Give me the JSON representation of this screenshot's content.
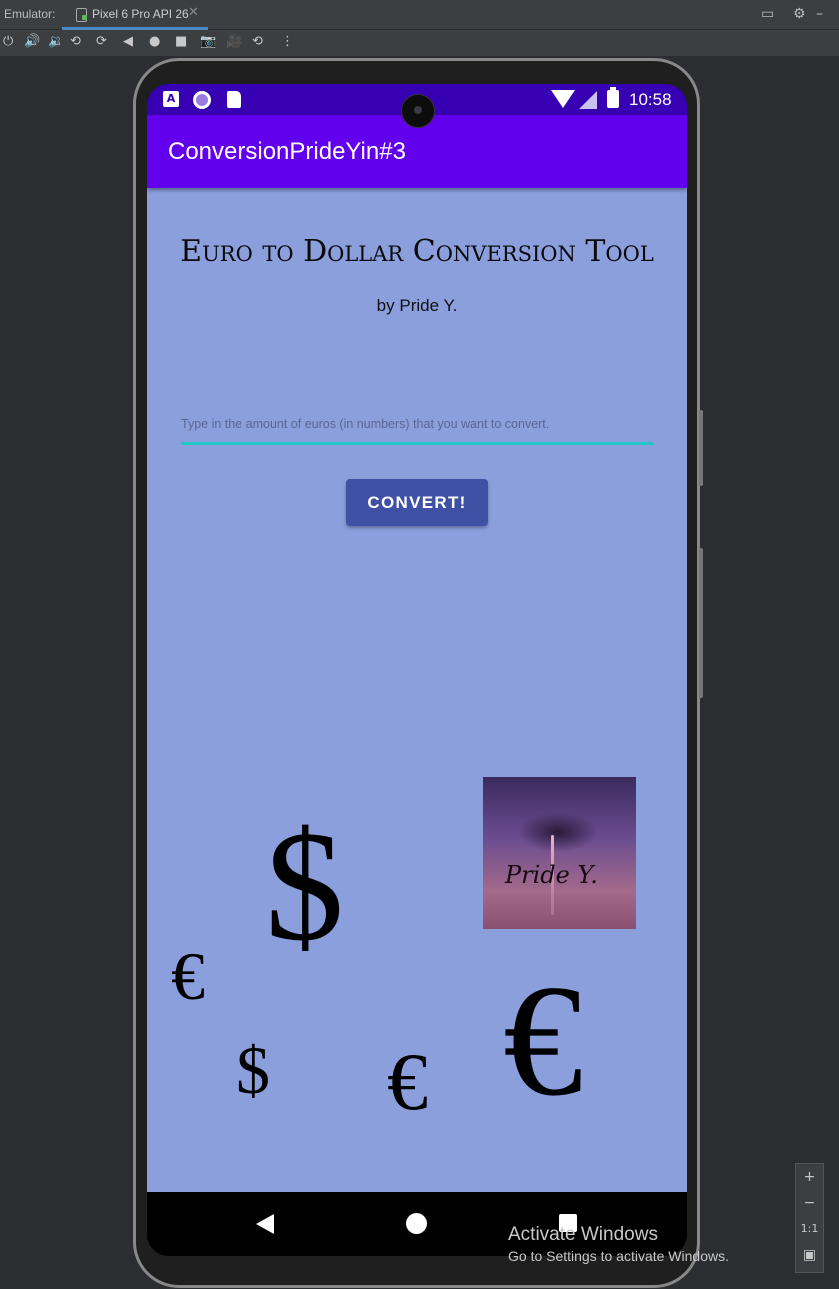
{
  "emulator": {
    "label": "Emulator:",
    "device_tab": "Pixel 6 Pro API 26",
    "tab_close": "✕"
  },
  "toolbar_icons": [
    "power-icon",
    "volume-up-icon",
    "volume-down-icon",
    "rotate-left-icon",
    "rotate-right-icon",
    "back-icon",
    "home-icon",
    "overview-icon",
    "screenshot-icon",
    "record-icon",
    "snapshot-icon",
    "more-icon"
  ],
  "status_bar": {
    "time": "10:58",
    "notif_letter": "A"
  },
  "app_bar": {
    "title": "ConversionPrideYin#3"
  },
  "main": {
    "heading": "Euro to Dollar Conversion Tool",
    "byline": "by Pride Y.",
    "input_placeholder": "Type in the amount of euros (in numbers) that you want to convert.",
    "convert_label": "CONVERT!",
    "photo_signature": "Pride Y."
  },
  "symbols": {
    "dollar": "$",
    "euro": "€"
  },
  "watermark": {
    "line1": "Activate Windows",
    "line2": "Go to Settings to activate Windows."
  },
  "zoom_controls": {
    "zoom_in": "+",
    "zoom_out": "−",
    "actual_size": "1:1"
  },
  "colors": {
    "status_bar": "#3700b3",
    "app_bar": "#6200ee",
    "content_bg": "#8b9fdd",
    "button": "#3f51a5",
    "input_underline": "#1fc6c8"
  }
}
